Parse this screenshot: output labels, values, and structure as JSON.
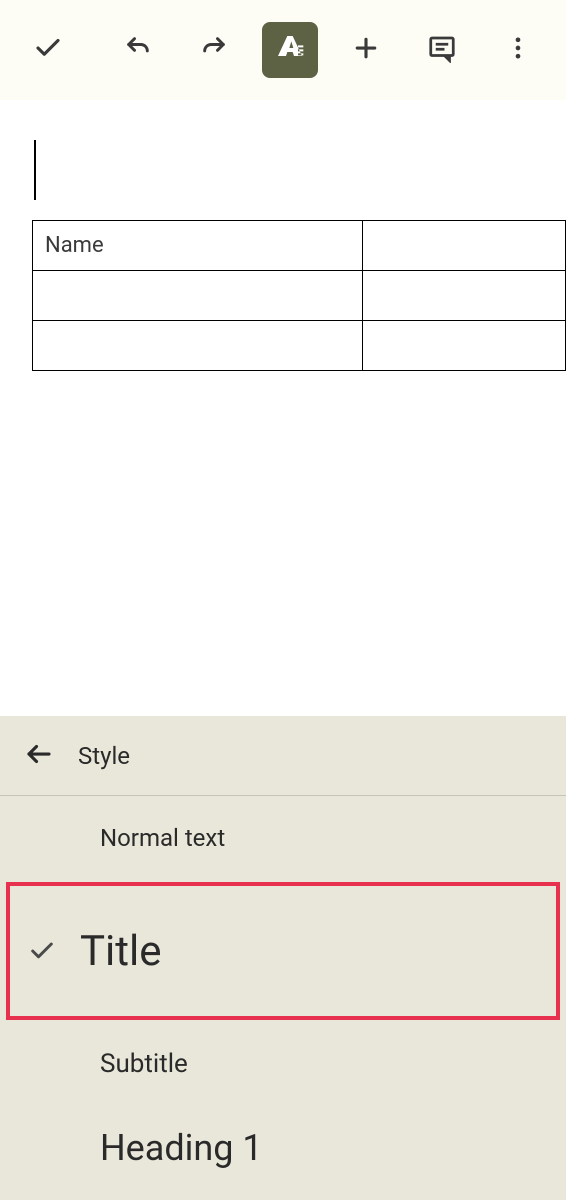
{
  "toolbar": {
    "accept_label": "accept",
    "undo_label": "undo",
    "redo_label": "redo",
    "format_label": "format",
    "insert_label": "insert",
    "comment_label": "comment",
    "more_label": "more"
  },
  "document": {
    "table": {
      "headers": [
        "Name",
        ""
      ],
      "rows": [
        [
          "",
          ""
        ],
        [
          "",
          ""
        ]
      ]
    }
  },
  "style_panel": {
    "title": "Style",
    "options": [
      {
        "label": "Normal text",
        "selected": false
      },
      {
        "label": "Title",
        "selected": true
      },
      {
        "label": "Subtitle",
        "selected": false
      },
      {
        "label": "Heading 1",
        "selected": false
      }
    ]
  }
}
